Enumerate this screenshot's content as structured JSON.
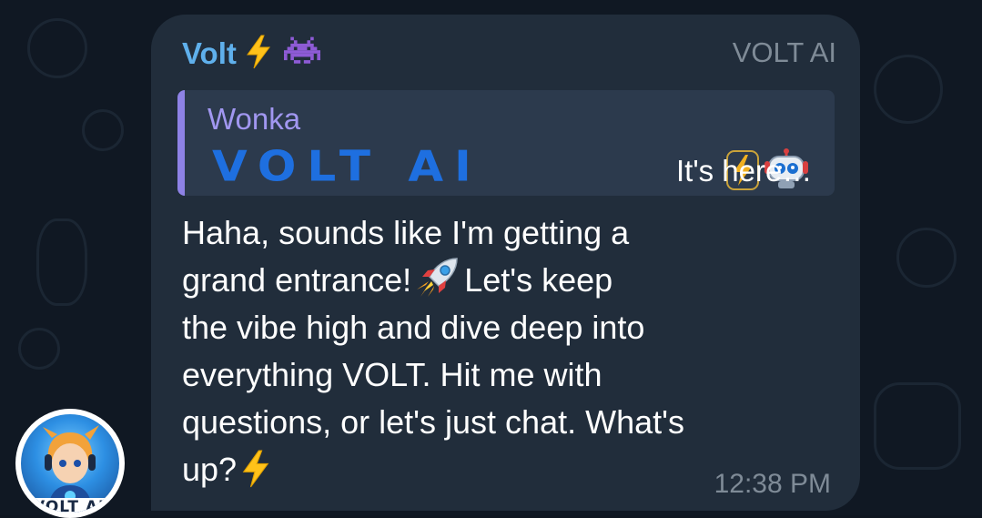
{
  "message": {
    "sender_name": "Volt",
    "sender_badge": "VOLT AI",
    "reply": {
      "author": "Wonka",
      "brand_text": "VOLT AI",
      "preview_text": "It's here…"
    },
    "body_lines": [
      "Haha, sounds like I'm getting a",
      "grand entrance!",
      "Let's keep",
      "the vibe high and dive deep into",
      "everything VOLT. Hit me with",
      "questions, or let's just chat. What's",
      "up?"
    ],
    "timestamp": "12:38 PM"
  },
  "avatar": {
    "label": "VOLT AI"
  },
  "icons": {
    "name_bolt": "lightning-bolt-icon",
    "name_invader": "space-invader-icon",
    "reply_bolt": "lightning-bolt-icon",
    "reply_robot": "robot-icon",
    "body_rocket": "rocket-icon",
    "body_bolt": "lightning-bolt-icon"
  },
  "colors": {
    "sender_name": "#5fb0ec",
    "reply_accent": "#8e82e6",
    "brand_blue": "#1e6fe0",
    "bubble": "#212d3b"
  }
}
